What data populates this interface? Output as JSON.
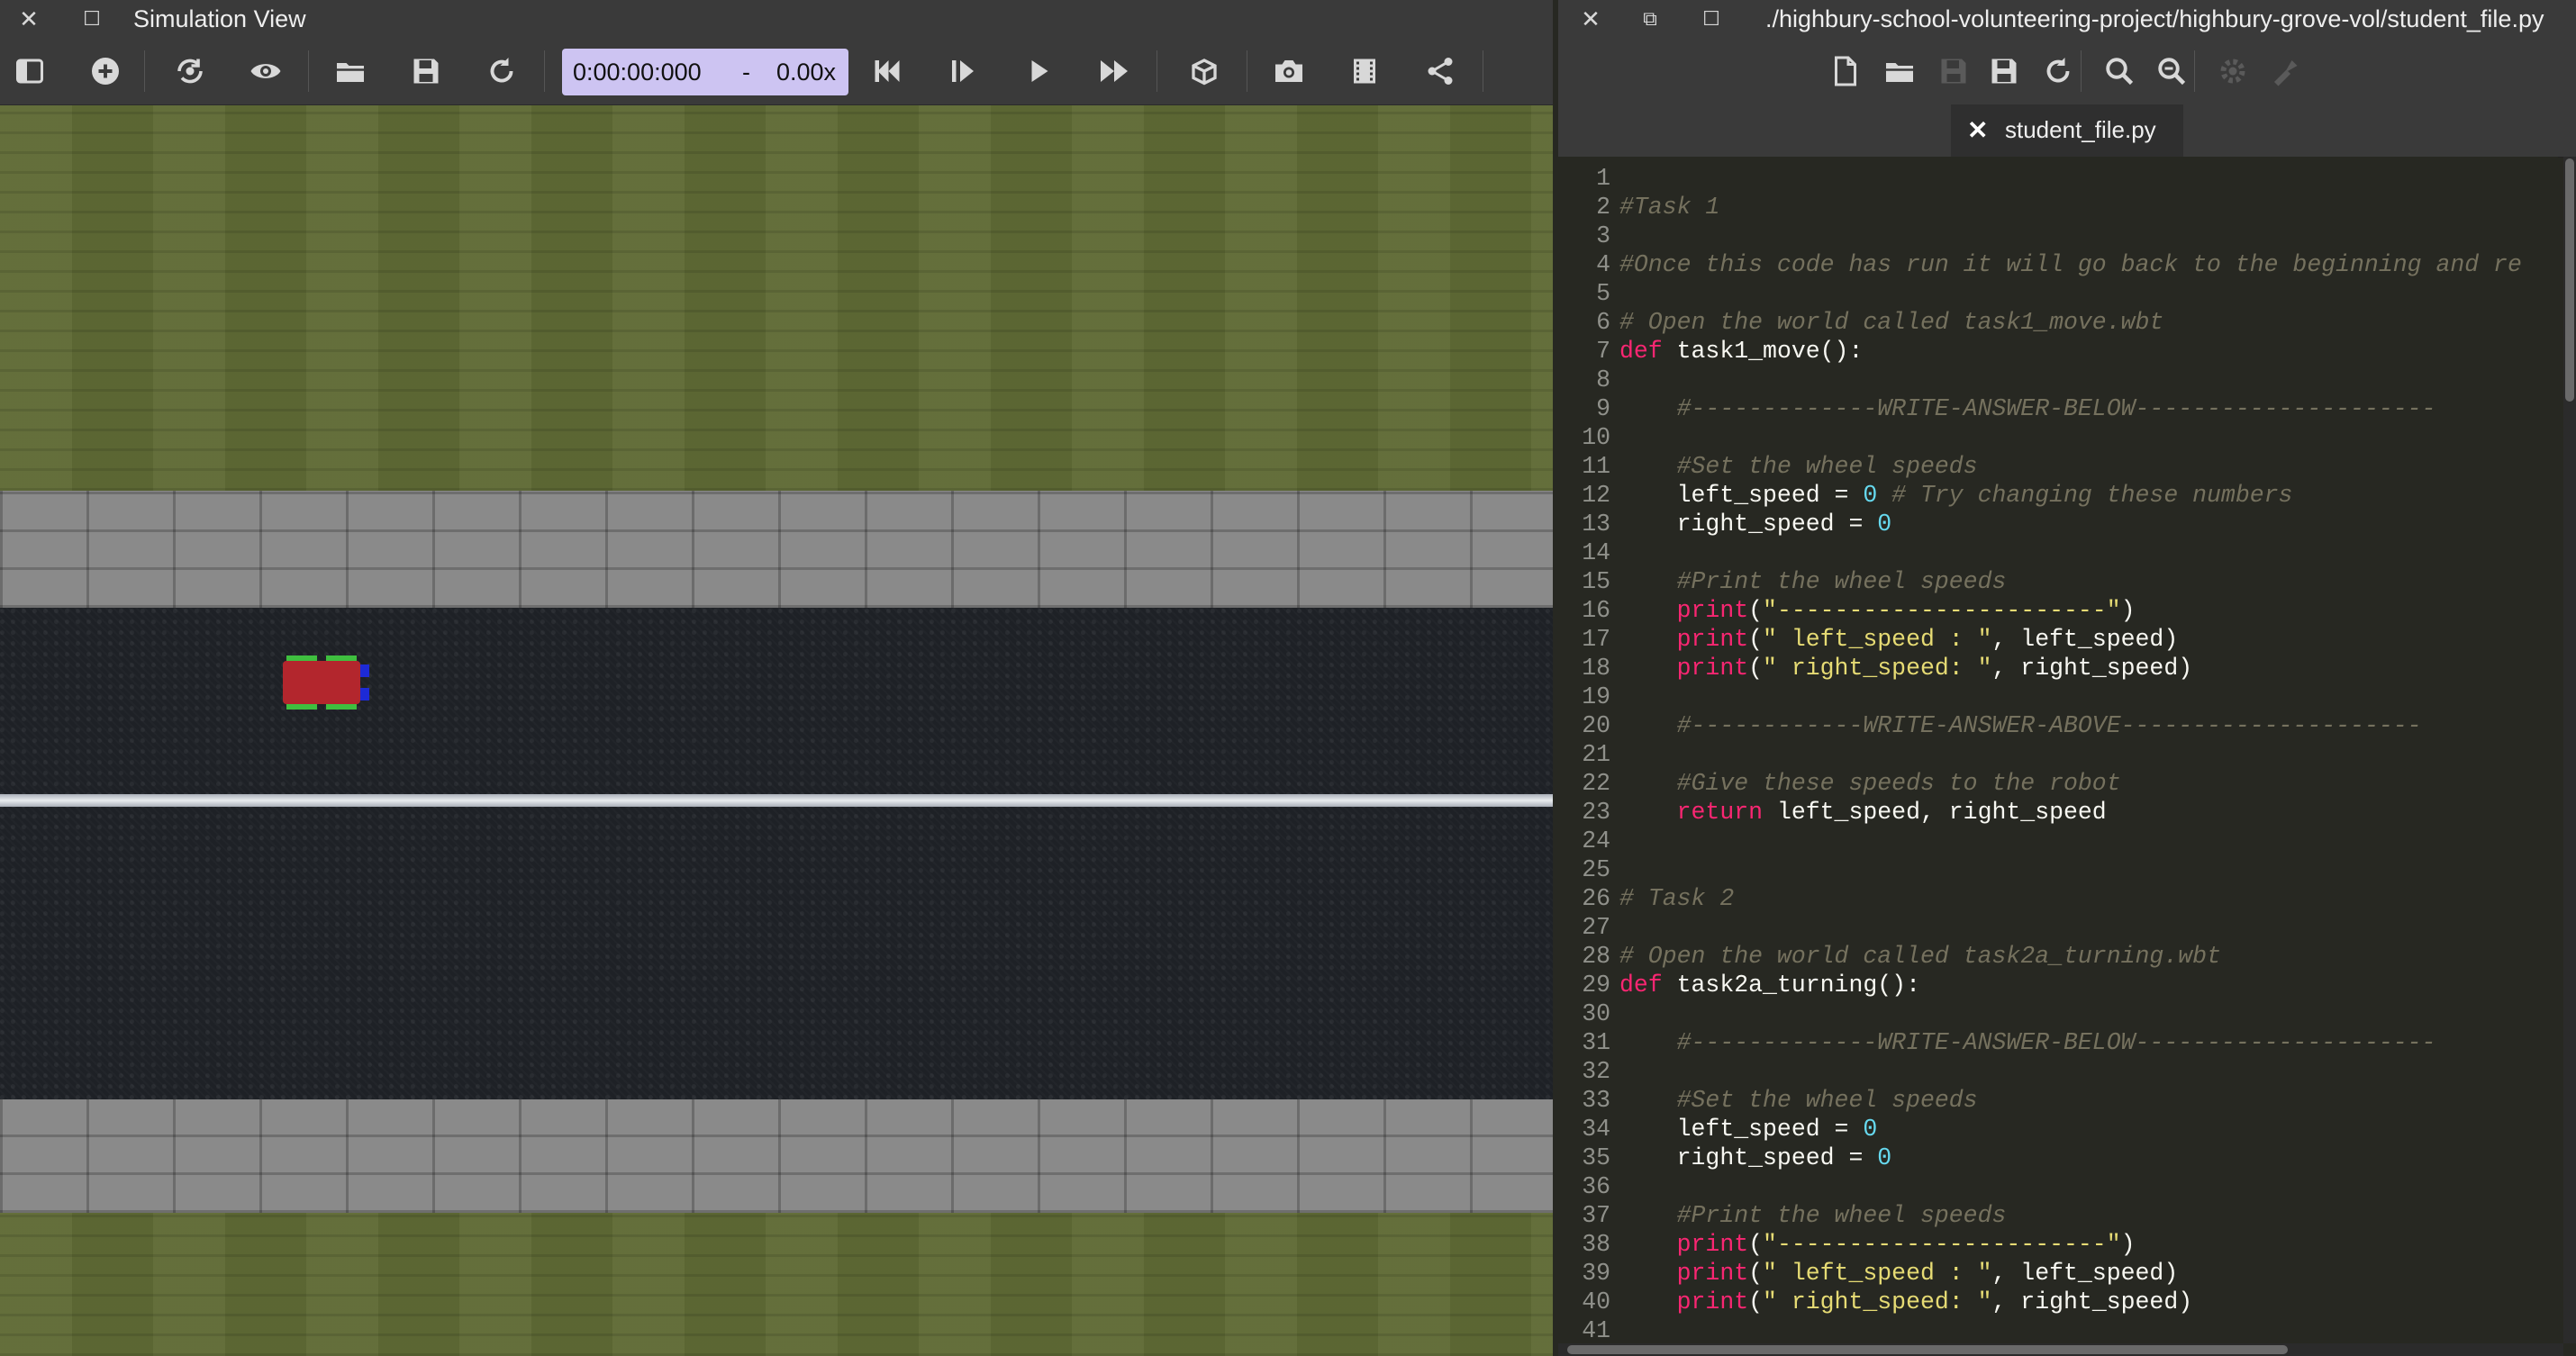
{
  "sim_window": {
    "title": "Simulation View",
    "time": "0:00:00:000",
    "time_separator": "-",
    "speed": "0.00x",
    "toolbar_icons": [
      "toggle-scene-tree-icon",
      "add-node-icon",
      "reset-view-icon",
      "eye-icon",
      "open-world-icon",
      "save-world-icon",
      "reload-world-icon",
      "reset-simulation-icon",
      "step-icon",
      "play-icon",
      "fast-forward-icon",
      "view-3d-icon",
      "screenshot-icon",
      "movie-icon",
      "share-icon"
    ]
  },
  "editor_window": {
    "title": "./highbury-school-volunteering-project/highbury-grove-vol/student_file.py",
    "tab_label": "student_file.py",
    "tab_close": "✕",
    "toolbar_icons": [
      "new-file-icon",
      "open-file-icon",
      "save-icon",
      "save-as-icon",
      "revert-icon",
      "find-icon",
      "replace-icon",
      "settings-icon",
      "tools-icon"
    ]
  },
  "code_lines": [
    {
      "n": "1",
      "tokens": []
    },
    {
      "n": "2",
      "tokens": [
        {
          "t": "comment",
          "v": "#Task 1"
        }
      ]
    },
    {
      "n": "3",
      "tokens": []
    },
    {
      "n": "4",
      "tokens": [
        {
          "t": "comment",
          "v": "#Once this code has run it will go back to the beginning and re"
        }
      ]
    },
    {
      "n": "5",
      "tokens": []
    },
    {
      "n": "6",
      "tokens": [
        {
          "t": "comment",
          "v": "# Open the world called task1_move.wbt"
        }
      ]
    },
    {
      "n": "7",
      "tokens": [
        {
          "t": "keyword",
          "v": "def"
        },
        {
          "t": "plain",
          "v": " task1_move():"
        }
      ]
    },
    {
      "n": "8",
      "tokens": []
    },
    {
      "n": "9",
      "tokens": [
        {
          "t": "plain",
          "v": "    "
        },
        {
          "t": "comment",
          "v": "#-------------WRITE-ANSWER-BELOW---------------------"
        }
      ]
    },
    {
      "n": "10",
      "tokens": []
    },
    {
      "n": "11",
      "tokens": [
        {
          "t": "plain",
          "v": "    "
        },
        {
          "t": "comment",
          "v": "#Set the wheel speeds"
        }
      ]
    },
    {
      "n": "12",
      "tokens": [
        {
          "t": "plain",
          "v": "    left_speed = "
        },
        {
          "t": "number",
          "v": "0"
        },
        {
          "t": "plain",
          "v": " "
        },
        {
          "t": "comment",
          "v": "# Try changing these numbers"
        }
      ]
    },
    {
      "n": "13",
      "tokens": [
        {
          "t": "plain",
          "v": "    right_speed = "
        },
        {
          "t": "number",
          "v": "0"
        }
      ]
    },
    {
      "n": "14",
      "tokens": []
    },
    {
      "n": "15",
      "tokens": [
        {
          "t": "plain",
          "v": "    "
        },
        {
          "t": "comment",
          "v": "#Print the wheel speeds"
        }
      ]
    },
    {
      "n": "16",
      "tokens": [
        {
          "t": "plain",
          "v": "    "
        },
        {
          "t": "builtin",
          "v": "print"
        },
        {
          "t": "plain",
          "v": "("
        },
        {
          "t": "string",
          "v": "\"-----------------------\""
        },
        {
          "t": "plain",
          "v": ")"
        }
      ]
    },
    {
      "n": "17",
      "tokens": [
        {
          "t": "plain",
          "v": "    "
        },
        {
          "t": "builtin",
          "v": "print"
        },
        {
          "t": "plain",
          "v": "("
        },
        {
          "t": "string",
          "v": "\" left_speed : \""
        },
        {
          "t": "plain",
          "v": ", left_speed)"
        }
      ]
    },
    {
      "n": "18",
      "tokens": [
        {
          "t": "plain",
          "v": "    "
        },
        {
          "t": "builtin",
          "v": "print"
        },
        {
          "t": "plain",
          "v": "("
        },
        {
          "t": "string",
          "v": "\" right_speed: \""
        },
        {
          "t": "plain",
          "v": ", right_speed)"
        }
      ]
    },
    {
      "n": "19",
      "tokens": []
    },
    {
      "n": "20",
      "tokens": [
        {
          "t": "plain",
          "v": "    "
        },
        {
          "t": "comment",
          "v": "#------------WRITE-ANSWER-ABOVE---------------------"
        }
      ]
    },
    {
      "n": "21",
      "tokens": []
    },
    {
      "n": "22",
      "tokens": [
        {
          "t": "plain",
          "v": "    "
        },
        {
          "t": "comment",
          "v": "#Give these speeds to the robot"
        }
      ]
    },
    {
      "n": "23",
      "tokens": [
        {
          "t": "plain",
          "v": "    "
        },
        {
          "t": "keyword",
          "v": "return"
        },
        {
          "t": "plain",
          "v": " left_speed, right_speed"
        }
      ]
    },
    {
      "n": "24",
      "tokens": []
    },
    {
      "n": "25",
      "tokens": []
    },
    {
      "n": "26",
      "tokens": [
        {
          "t": "comment",
          "v": "# Task 2"
        }
      ]
    },
    {
      "n": "27",
      "tokens": []
    },
    {
      "n": "28",
      "tokens": [
        {
          "t": "comment",
          "v": "# Open the world called task2a_turning.wbt"
        }
      ]
    },
    {
      "n": "29",
      "tokens": [
        {
          "t": "keyword",
          "v": "def"
        },
        {
          "t": "plain",
          "v": " task2a_turning():"
        }
      ]
    },
    {
      "n": "30",
      "tokens": []
    },
    {
      "n": "31",
      "tokens": [
        {
          "t": "plain",
          "v": "    "
        },
        {
          "t": "comment",
          "v": "#-------------WRITE-ANSWER-BELOW---------------------"
        }
      ]
    },
    {
      "n": "32",
      "tokens": []
    },
    {
      "n": "33",
      "tokens": [
        {
          "t": "plain",
          "v": "    "
        },
        {
          "t": "comment",
          "v": "#Set the wheel speeds"
        }
      ]
    },
    {
      "n": "34",
      "tokens": [
        {
          "t": "plain",
          "v": "    left_speed = "
        },
        {
          "t": "number",
          "v": "0"
        }
      ]
    },
    {
      "n": "35",
      "tokens": [
        {
          "t": "plain",
          "v": "    right_speed = "
        },
        {
          "t": "number",
          "v": "0"
        }
      ]
    },
    {
      "n": "36",
      "tokens": []
    },
    {
      "n": "37",
      "tokens": [
        {
          "t": "plain",
          "v": "    "
        },
        {
          "t": "comment",
          "v": "#Print the wheel speeds"
        }
      ]
    },
    {
      "n": "38",
      "tokens": [
        {
          "t": "plain",
          "v": "    "
        },
        {
          "t": "builtin",
          "v": "print"
        },
        {
          "t": "plain",
          "v": "("
        },
        {
          "t": "string",
          "v": "\"-----------------------\""
        },
        {
          "t": "plain",
          "v": ")"
        }
      ]
    },
    {
      "n": "39",
      "tokens": [
        {
          "t": "plain",
          "v": "    "
        },
        {
          "t": "builtin",
          "v": "print"
        },
        {
          "t": "plain",
          "v": "("
        },
        {
          "t": "string",
          "v": "\" left_speed : \""
        },
        {
          "t": "plain",
          "v": ", left_speed)"
        }
      ]
    },
    {
      "n": "40",
      "tokens": [
        {
          "t": "plain",
          "v": "    "
        },
        {
          "t": "builtin",
          "v": "print"
        },
        {
          "t": "plain",
          "v": "("
        },
        {
          "t": "string",
          "v": "\" right_speed: \""
        },
        {
          "t": "plain",
          "v": ", right_speed)"
        }
      ]
    },
    {
      "n": "41",
      "tokens": []
    }
  ],
  "colors": {
    "time_box_bg": "#cdc4f2",
    "robot_body": "#b3262d",
    "robot_wheels": "#3fbf3f",
    "robot_sensor": "#1d2ad6",
    "grass": "#5f6a35",
    "road": "#1e2126",
    "wall": "#8a8a8a"
  }
}
